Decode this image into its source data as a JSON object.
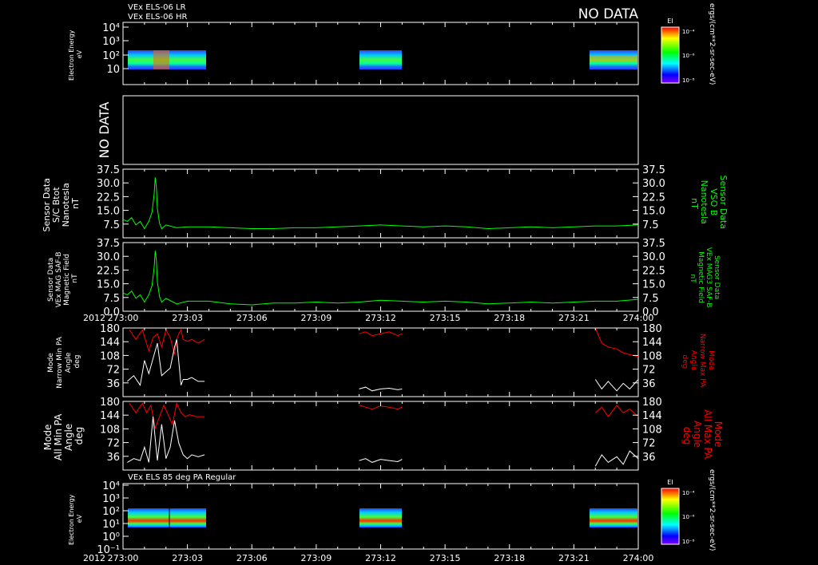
{
  "header": {
    "line1": "VEx ELS-06 LR",
    "line2": "VEx ELS-06 HR",
    "no_data_top": "NO DATA"
  },
  "colors": {
    "background": "#000000",
    "frame": "#ffffff",
    "magnetometer": "#00ff00",
    "max_pa": "#ff0000",
    "min_pa": "#ffffff"
  },
  "time_axis": {
    "year": "2012",
    "ticks": [
      "273:00",
      "273:03",
      "273:06",
      "273:09",
      "273:12",
      "273:15",
      "273:18",
      "273:21",
      "274:00"
    ]
  },
  "chart_data": [
    {
      "type": "heatmap",
      "name": "els-lr-hr-spectrogram",
      "ylabel": [
        "Electron Energy",
        "eV"
      ],
      "yscale": "log",
      "yticks": [
        "10",
        "10²",
        "10³",
        "10⁴"
      ],
      "colorbar": {
        "title": "EI",
        "ticks": [
          "10⁻⁴",
          "10⁻⁶",
          "10⁻⁸"
        ],
        "label": "ergs/(cm**2-sr-sec-eV)"
      },
      "data_intervals": [
        [
          "273:00",
          "273:03"
        ],
        [
          "273:11",
          "273:13"
        ],
        [
          "273:22",
          "274:00"
        ]
      ]
    },
    {
      "type": "line",
      "name": "empty-panel",
      "text": "NO DATA"
    },
    {
      "type": "line",
      "name": "sc-btot",
      "ylabel_left": [
        "Sensor Data",
        "S/C Btot",
        "Nanotesla",
        "nT"
      ],
      "ylabel_right": [
        "Sensor Data",
        "VSO B",
        "Nanotesla",
        "nT"
      ],
      "ylim": [
        0,
        37.5
      ],
      "yticks": [
        "7.5",
        "15.0",
        "22.5",
        "30.0",
        "37.5"
      ],
      "x_minutes": [
        0,
        0.2,
        0.4,
        0.6,
        0.8,
        1.0,
        1.1,
        1.2,
        1.35,
        1.45,
        1.5,
        1.55,
        1.6,
        1.7,
        1.8,
        1.9,
        2.0,
        2.5,
        3.0,
        4.0,
        5.0,
        6.0,
        7.0,
        8.0,
        9.0,
        10.0,
        11.0,
        12.0,
        13.0,
        14.0,
        15.0,
        16.0,
        17.0,
        18.0,
        19.0,
        20.0,
        21.0,
        22.0,
        23.0,
        24.0
      ],
      "values": [
        10,
        9,
        11,
        7,
        9,
        5,
        7,
        9,
        14,
        24,
        33,
        28,
        16,
        8,
        5,
        6,
        7,
        5.5,
        6,
        6,
        5.5,
        5,
        5,
        5.5,
        5.5,
        6,
        6.5,
        7,
        6.5,
        6,
        6.5,
        6,
        5,
        5.5,
        6,
        5.5,
        6,
        6.5,
        6.5,
        7
      ]
    },
    {
      "type": "line",
      "name": "vso-b-magnitude",
      "ylabel_left": [
        "Sensor Data",
        "VEx MAG SAF-B",
        "Magnetic Field",
        "nT"
      ],
      "ylabel_right": [
        "Sensor Data",
        "VEx MAG3 SAF-B",
        "Magnetic Field",
        "nT"
      ],
      "ylim": [
        0,
        37.5
      ],
      "yticks": [
        "0.0",
        "7.5",
        "15.0",
        "22.5",
        "30.0",
        "37.5"
      ],
      "x_minutes": [
        0,
        0.2,
        0.4,
        0.6,
        0.8,
        1.0,
        1.1,
        1.2,
        1.35,
        1.45,
        1.5,
        1.55,
        1.6,
        1.7,
        1.8,
        1.9,
        2.0,
        2.5,
        3.0,
        4.0,
        5.0,
        6.0,
        7.0,
        8.0,
        9.0,
        10.0,
        11.0,
        12.0,
        13.0,
        14.0,
        15.0,
        16.0,
        17.0,
        18.0,
        19.0,
        20.0,
        21.0,
        22.0,
        23.0,
        24.0
      ],
      "values": [
        10,
        9,
        11,
        7,
        9,
        5,
        7,
        9,
        14,
        24,
        33,
        28,
        16,
        8,
        5,
        6,
        7,
        4,
        5.5,
        5.5,
        4,
        3.5,
        4.5,
        4.5,
        5,
        4.5,
        5,
        6,
        5.5,
        5,
        5.5,
        5,
        4,
        4.5,
        5,
        4.5,
        5,
        5.5,
        5.5,
        6.5
      ]
    },
    {
      "type": "line",
      "name": "narrow-pa",
      "ylabel_left": [
        "Mode",
        "Narrow Min PA",
        "Angle",
        "deg"
      ],
      "ylabel_right": [
        "Mode",
        "Narrow Max PA",
        "Angle",
        "deg"
      ],
      "ylim": [
        0,
        180
      ],
      "yticks": [
        "36",
        "72",
        "108",
        "144",
        "180"
      ],
      "series": [
        {
          "segments": [
            {
              "x": [
                0.3,
                0.6,
                0.9,
                1.2,
                1.4,
                1.6,
                1.8,
                2.0,
                2.2,
                2.4,
                2.5,
                2.6,
                2.7,
                2.8,
                3.0,
                3.2,
                3.5,
                3.8
              ],
              "y": [
                175,
                150,
                175,
                120,
                155,
                165,
                130,
                175,
                155,
                110,
                150,
                165,
                175,
                150,
                145,
                150,
                140,
                150
              ]
            },
            {
              "x": [
                11.0,
                11.3,
                11.6,
                12.0,
                12.4,
                12.8,
                13.0
              ],
              "y": [
                165,
                170,
                160,
                165,
                170,
                160,
                165
              ]
            },
            {
              "x": [
                22.0,
                22.3,
                22.6,
                23.0,
                23.3,
                23.6,
                24.0
              ],
              "y": [
                180,
                140,
                130,
                125,
                115,
                110,
                105
              ]
            }
          ]
        },
        {
          "segments": [
            {
              "x": [
                0.2,
                0.5,
                0.8,
                1.0,
                1.2,
                1.4,
                1.6,
                1.8,
                2.0,
                2.2,
                2.4,
                2.5,
                2.6,
                2.7,
                2.8,
                3.0,
                3.2,
                3.5,
                3.8
              ],
              "y": [
                40,
                55,
                30,
                95,
                60,
                100,
                140,
                55,
                65,
                75,
                130,
                150,
                90,
                30,
                45,
                45,
                50,
                40,
                40
              ]
            },
            {
              "x": [
                11.0,
                11.3,
                11.6,
                12.0,
                12.4,
                12.8,
                13.0
              ],
              "y": [
                20,
                25,
                15,
                20,
                22,
                18,
                20
              ]
            },
            {
              "x": [
                22.0,
                22.3,
                22.6,
                23.0,
                23.3,
                23.6,
                24.0
              ],
              "y": [
                45,
                20,
                40,
                15,
                35,
                20,
                45
              ]
            }
          ]
        }
      ]
    },
    {
      "type": "line",
      "name": "all-pa",
      "ylabel_left": [
        "Mode",
        "All Min PA",
        "Angle",
        "deg"
      ],
      "ylabel_right": [
        "Mode",
        "All Max PA",
        "Angle",
        "deg"
      ],
      "ylim": [
        0,
        180
      ],
      "yticks": [
        "36",
        "72",
        "108",
        "144",
        "180"
      ],
      "series": [
        {
          "segments": [
            {
              "x": [
                0.3,
                0.6,
                0.9,
                1.1,
                1.3,
                1.5,
                1.7,
                1.9,
                2.1,
                2.3,
                2.5,
                2.7,
                2.9,
                3.1,
                3.4,
                3.8
              ],
              "y": [
                175,
                150,
                175,
                150,
                170,
                110,
                140,
                170,
                145,
                120,
                175,
                150,
                140,
                145,
                140,
                140
              ]
            },
            {
              "x": [
                11.0,
                11.3,
                11.6,
                12.0,
                12.4,
                12.8,
                13.0
              ],
              "y": [
                170,
                165,
                160,
                168,
                165,
                160,
                165
              ]
            },
            {
              "x": [
                22.0,
                22.3,
                22.6,
                23.0,
                23.3,
                23.6,
                24.0
              ],
              "y": [
                150,
                165,
                140,
                170,
                150,
                160,
                140
              ]
            }
          ]
        },
        {
          "segments": [
            {
              "x": [
                0.2,
                0.5,
                0.8,
                1.0,
                1.2,
                1.4,
                1.6,
                1.8,
                2.0,
                2.2,
                2.4,
                2.6,
                2.8,
                3.0,
                3.2,
                3.5,
                3.8
              ],
              "y": [
                20,
                30,
                25,
                60,
                20,
                140,
                25,
                120,
                30,
                60,
                130,
                70,
                40,
                30,
                40,
                35,
                40
              ]
            },
            {
              "x": [
                11.0,
                11.3,
                11.6,
                12.0,
                12.4,
                12.8,
                13.0
              ],
              "y": [
                25,
                30,
                20,
                28,
                25,
                22,
                28
              ]
            },
            {
              "x": [
                22.0,
                22.3,
                22.6,
                23.0,
                23.3,
                23.6,
                24.0
              ],
              "y": [
                10,
                40,
                20,
                35,
                15,
                50,
                30
              ]
            }
          ]
        }
      ]
    },
    {
      "type": "heatmap",
      "name": "els-85deg-pa-spectrogram",
      "title": "VEx ELS 85 deg PA Regular",
      "ylabel": [
        "Electron Energy",
        "eV"
      ],
      "yscale": "log",
      "yticks": [
        "10⁻¹",
        "10⁰",
        "10¹",
        "10²",
        "10³",
        "10⁴"
      ],
      "colorbar": {
        "title": "EI",
        "ticks": [
          "10⁻⁴",
          "10⁻⁶",
          "10⁻⁸"
        ],
        "label": "ergs/(cm**2-sr-sec-eV)"
      },
      "data_intervals": [
        [
          "273:00",
          "273:03"
        ],
        [
          "273:11",
          "273:13"
        ],
        [
          "273:22",
          "274:00"
        ]
      ]
    }
  ]
}
